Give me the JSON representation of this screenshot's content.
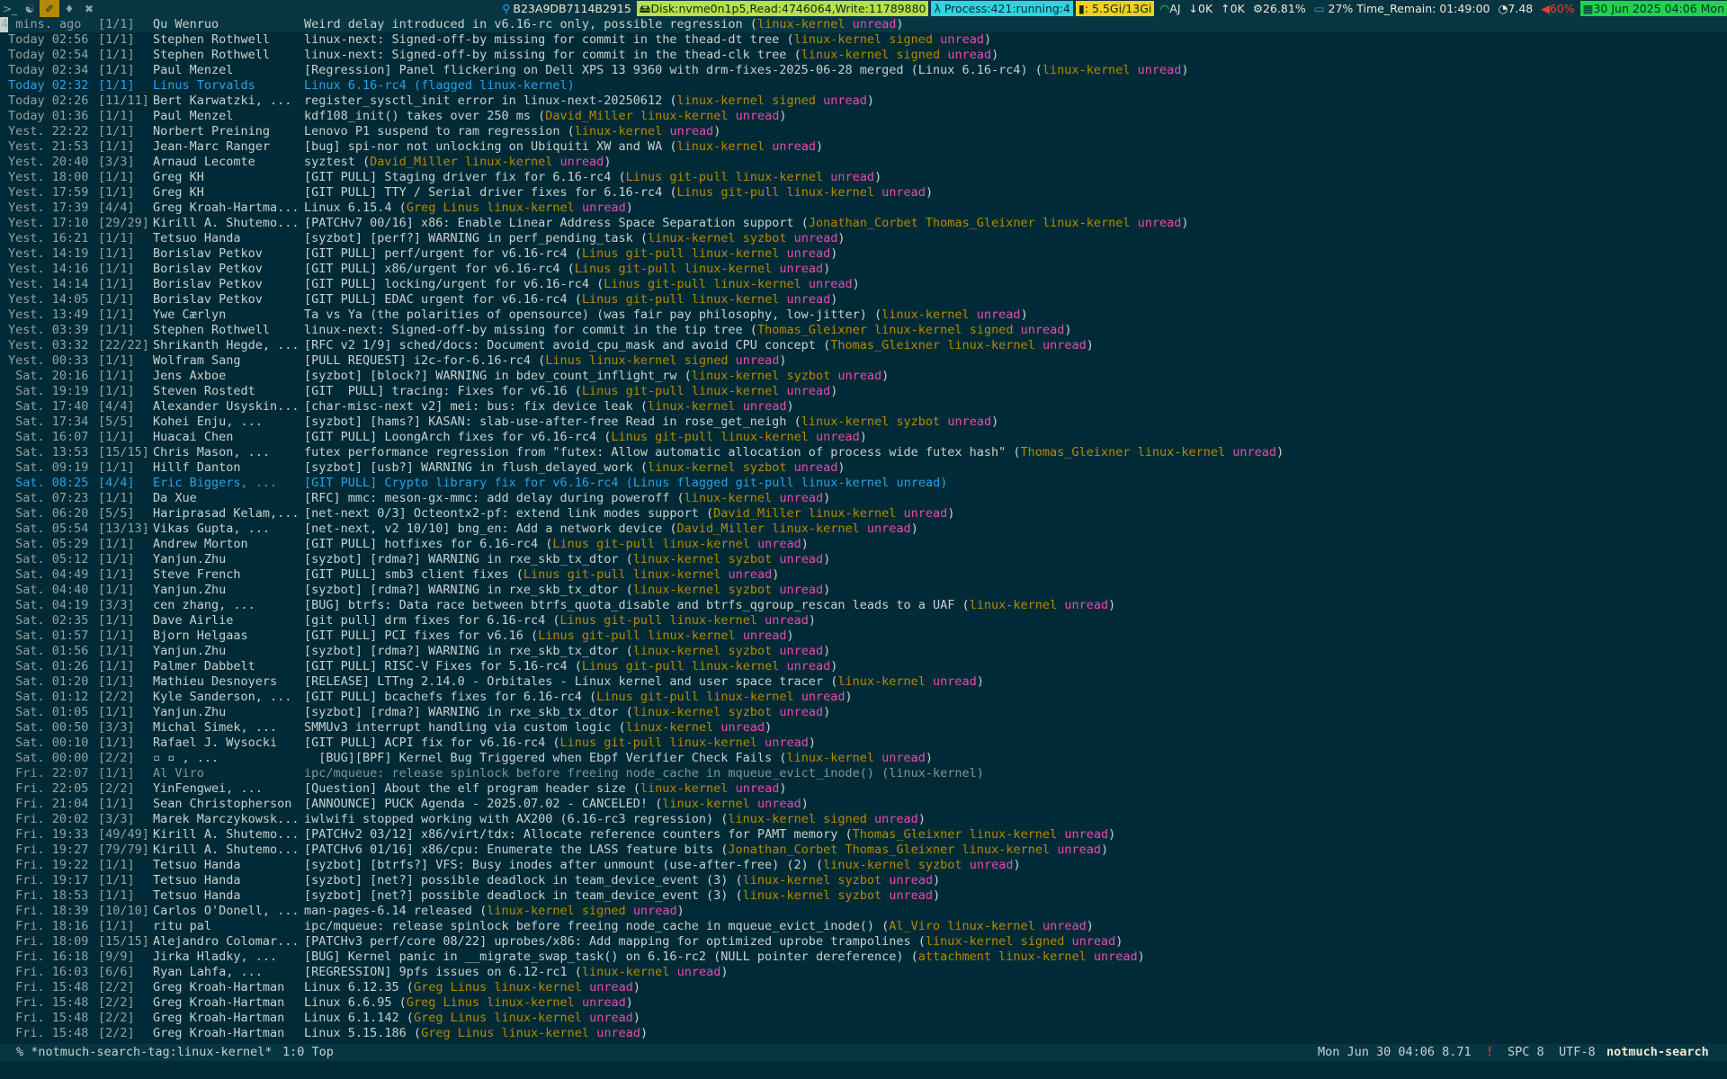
{
  "topbar": {
    "workspaces": [
      {
        "icon": "terminal-icon",
        "glyph": ">_"
      },
      {
        "icon": "emacs-icon",
        "glyph": "☯"
      },
      {
        "icon": "firefox-icon",
        "glyph": "✐"
      },
      {
        "icon": "bell-icon",
        "glyph": "♦"
      },
      {
        "icon": "tools-icon",
        "glyph": "✖"
      }
    ],
    "active_workspace": 2,
    "ip": "B23A9DB7114B2915",
    "disk": "Disk:nvme0n1p5,Read:4746064,Write:11789880",
    "process": "Process:421:running:4",
    "memory": ": 5.5Gi/13Gi",
    "wifi": "AJ",
    "down": "0K",
    "up": "0K",
    "cpu": "26.81%",
    "battery": "27% Time_Remain: 01:49:00",
    "load": "7.48",
    "temp": "60%",
    "datetime": "30 Jun 2025 04:06 Mon"
  },
  "rows": [
    {
      "date": "4 mins. ago",
      "count": "[1/1]",
      "author": "Qu Wenruo",
      "subject": "Weird delay introduced in v6.16-rc only, possible regression",
      "tags": [
        "linux-kernel",
        "unread"
      ]
    },
    {
      "date": "Today 02:56",
      "count": "[1/1]",
      "author": "Stephen Rothwell",
      "subject": "linux-next: Signed-off-by missing for commit in the thead-dt tree",
      "tags": [
        "linux-kernel",
        "signed",
        "unread"
      ]
    },
    {
      "date": "Today 02:54",
      "count": "[1/1]",
      "author": "Stephen Rothwell",
      "subject": "linux-next: Signed-off-by missing for commit in the thead-clk tree",
      "tags": [
        "linux-kernel",
        "signed",
        "unread"
      ]
    },
    {
      "date": "Today 02:34",
      "count": "[1/1]",
      "author": "Paul Menzel",
      "subject": "[Regression] Panel flickering on Dell XPS 13 9360 with drm-fixes-2025-06-28 merged (Linux 6.16-rc4)",
      "tags": [
        "linux-kernel",
        "unread"
      ]
    },
    {
      "date": "Today 02:32",
      "count": "[1/1]",
      "author": "Linus Torvalds",
      "subject": "Linux 6.16-rc4",
      "tags": [
        "flagged",
        "linux-kernel"
      ],
      "flagged": true
    },
    {
      "date": "Today 02:26",
      "count": "[11/11]",
      "author": "Bert Karwatzki, ...",
      "subject": "register_sysctl_init error in linux-next-20250612",
      "tags": [
        "linux-kernel",
        "signed",
        "unread"
      ]
    },
    {
      "date": "Today 01:36",
      "count": "[1/1]",
      "author": "Paul Menzel",
      "subject": "kdf108_init() takes over 250 ms",
      "tags": [
        "David_Miller",
        "linux-kernel",
        "unread"
      ]
    },
    {
      "date": "Yest. 22:22",
      "count": "[1/1]",
      "author": "Norbert Preining",
      "subject": "Lenovo P1 suspend to ram regression",
      "tags": [
        "linux-kernel",
        "unread"
      ]
    },
    {
      "date": "Yest. 21:53",
      "count": "[1/1]",
      "author": "Jean-Marc Ranger",
      "subject": "[bug] spi-nor not unlocking on Ubiquiti XW and WA",
      "tags": [
        "linux-kernel",
        "unread"
      ]
    },
    {
      "date": "Yest. 20:40",
      "count": "[3/3]",
      "author": "Arnaud Lecomte",
      "subject": "syztest",
      "tags": [
        "David_Miller",
        "linux-kernel",
        "unread"
      ]
    },
    {
      "date": "Yest. 18:00",
      "count": "[1/1]",
      "author": "Greg KH",
      "subject": "[GIT PULL] Staging driver fix for 6.16-rc4",
      "tags": [
        "Linus",
        "git-pull",
        "linux-kernel",
        "unread"
      ]
    },
    {
      "date": "Yest. 17:59",
      "count": "[1/1]",
      "author": "Greg KH",
      "subject": "[GIT PULL] TTY / Serial driver fixes for 6.16-rc4",
      "tags": [
        "Linus",
        "git-pull",
        "linux-kernel",
        "unread"
      ]
    },
    {
      "date": "Yest. 17:39",
      "count": "[4/4]",
      "author": "Greg Kroah-Hartma...",
      "subject": "Linux 6.15.4",
      "tags": [
        "Greg",
        "Linus",
        "linux-kernel",
        "unread"
      ]
    },
    {
      "date": "Yest. 17:10",
      "count": "[29/29]",
      "author": "Kirill A. Shutemo...",
      "subject": "[PATCHv7 00/16] x86: Enable Linear Address Space Separation support",
      "tags": [
        "Jonathan_Corbet",
        "Thomas_Gleixner",
        "linux-kernel",
        "unread"
      ]
    },
    {
      "date": "Yest. 16:21",
      "count": "[1/1]",
      "author": "Tetsuo Handa",
      "subject": "[syzbot] [perf?] WARNING in perf_pending_task",
      "tags": [
        "linux-kernel",
        "syzbot",
        "unread"
      ]
    },
    {
      "date": "Yest. 14:19",
      "count": "[1/1]",
      "author": "Borislav Petkov",
      "subject": "[GIT PULL] perf/urgent for v6.16-rc4",
      "tags": [
        "Linus",
        "git-pull",
        "linux-kernel",
        "unread"
      ]
    },
    {
      "date": "Yest. 14:16",
      "count": "[1/1]",
      "author": "Borislav Petkov",
      "subject": "[GIT PULL] x86/urgent for v6.16-rc4",
      "tags": [
        "Linus",
        "git-pull",
        "linux-kernel",
        "unread"
      ]
    },
    {
      "date": "Yest. 14:14",
      "count": "[1/1]",
      "author": "Borislav Petkov",
      "subject": "[GIT PULL] locking/urgent for v6.16-rc4",
      "tags": [
        "Linus",
        "git-pull",
        "linux-kernel",
        "unread"
      ]
    },
    {
      "date": "Yest. 14:05",
      "count": "[1/1]",
      "author": "Borislav Petkov",
      "subject": "[GIT PULL] EDAC urgent for v6.16-rc4",
      "tags": [
        "Linus",
        "git-pull",
        "linux-kernel",
        "unread"
      ]
    },
    {
      "date": "Yest. 13:49",
      "count": "[1/1]",
      "author": "Ywe Cærlyn",
      "subject": "Ta vs Ya (the polarities of opensource) (was fair pay philosophy, low-jitter)",
      "tags": [
        "linux-kernel",
        "unread"
      ]
    },
    {
      "date": "Yest. 03:39",
      "count": "[1/1]",
      "author": "Stephen Rothwell",
      "subject": "linux-next: Signed-off-by missing for commit in the tip tree",
      "tags": [
        "Thomas_Gleixner",
        "linux-kernel",
        "signed",
        "unread"
      ]
    },
    {
      "date": "Yest. 03:32",
      "count": "[22/22]",
      "author": "Shrikanth Hegde, ...",
      "subject": "[RFC v2 1/9] sched/docs: Document avoid_cpu_mask and avoid CPU concept",
      "tags": [
        "Thomas_Gleixner",
        "linux-kernel",
        "unread"
      ]
    },
    {
      "date": "Yest. 00:33",
      "count": "[1/1]",
      "author": "Wolfram Sang",
      "subject": "[PULL REQUEST] i2c-for-6.16-rc4",
      "tags": [
        "Linus",
        "linux-kernel",
        "signed",
        "unread"
      ]
    },
    {
      "date": " Sat. 20:16",
      "count": "[1/1]",
      "author": "Jens Axboe",
      "subject": "[syzbot] [block?] WARNING in bdev_count_inflight_rw",
      "tags": [
        "linux-kernel",
        "syzbot",
        "unread"
      ]
    },
    {
      "date": " Sat. 19:19",
      "count": "[1/1]",
      "author": "Steven Rostedt",
      "subject": "[GIT  PULL] tracing: Fixes for v6.16",
      "tags": [
        "Linus",
        "git-pull",
        "linux-kernel",
        "unread"
      ]
    },
    {
      "date": " Sat. 17:40",
      "count": "[4/4]",
      "author": "Alexander Usyskin...",
      "subject": "[char-misc-next v2] mei: bus: fix device leak",
      "tags": [
        "linux-kernel",
        "unread"
      ]
    },
    {
      "date": " Sat. 17:34",
      "count": "[5/5]",
      "author": "Kohei Enju, ...",
      "subject": "[syzbot] [hams?] KASAN: slab-use-after-free Read in rose_get_neigh",
      "tags": [
        "linux-kernel",
        "syzbot",
        "unread"
      ]
    },
    {
      "date": " Sat. 16:07",
      "count": "[1/1]",
      "author": "Huacai Chen",
      "subject": "[GIT PULL] LoongArch fixes for v6.16-rc4",
      "tags": [
        "Linus",
        "git-pull",
        "linux-kernel",
        "unread"
      ]
    },
    {
      "date": " Sat. 13:53",
      "count": "[15/15]",
      "author": "Chris Mason, ...",
      "subject": "futex performance regression from \"futex: Allow automatic allocation of process wide futex hash\"",
      "tags": [
        "Thomas_Gleixner",
        "linux-kernel",
        "unread"
      ]
    },
    {
      "date": " Sat. 09:19",
      "count": "[1/1]",
      "author": "Hillf Danton",
      "subject": "[syzbot] [usb?] WARNING in flush_delayed_work",
      "tags": [
        "linux-kernel",
        "syzbot",
        "unread"
      ]
    },
    {
      "date": " Sat. 08:25",
      "count": "[4/4]",
      "author": "Eric Biggers, ...",
      "subject": "[GIT PULL] Crypto library fix for v6.16-rc4",
      "tags": [
        "Linus",
        "flagged",
        "git-pull",
        "linux-kernel",
        "unread"
      ],
      "flagged": true
    },
    {
      "date": " Sat. 07:23",
      "count": "[1/1]",
      "author": "Da Xue",
      "subject": "[RFC] mmc: meson-gx-mmc: add delay during poweroff",
      "tags": [
        "linux-kernel",
        "unread"
      ]
    },
    {
      "date": " Sat. 06:20",
      "count": "[5/5]",
      "author": "Hariprasad Kelam,...",
      "subject": "[net-next 0/3] Octeontx2-pf: extend link modes support",
      "tags": [
        "David_Miller",
        "linux-kernel",
        "unread"
      ]
    },
    {
      "date": " Sat. 05:54",
      "count": "[13/13]",
      "author": "Vikas Gupta, ...",
      "subject": "[net-next, v2 10/10] bng_en: Add a network device",
      "tags": [
        "David_Miller",
        "linux-kernel",
        "unread"
      ]
    },
    {
      "date": " Sat. 05:29",
      "count": "[1/1]",
      "author": "Andrew Morton",
      "subject": "[GIT PULL] hotfixes for 6.16-rc4",
      "tags": [
        "Linus",
        "git-pull",
        "linux-kernel",
        "unread"
      ]
    },
    {
      "date": " Sat. 05:12",
      "count": "[1/1]",
      "author": "Yanjun.Zhu",
      "subject": "[syzbot] [rdma?] WARNING in rxe_skb_tx_dtor",
      "tags": [
        "linux-kernel",
        "syzbot",
        "unread"
      ]
    },
    {
      "date": " Sat. 04:49",
      "count": "[1/1]",
      "author": "Steve French",
      "subject": "[GIT PULL] smb3 client fixes",
      "tags": [
        "Linus",
        "git-pull",
        "linux-kernel",
        "unread"
      ]
    },
    {
      "date": " Sat. 04:40",
      "count": "[1/1]",
      "author": "Yanjun.Zhu",
      "subject": "[syzbot] [rdma?] WARNING in rxe_skb_tx_dtor",
      "tags": [
        "linux-kernel",
        "syzbot",
        "unread"
      ]
    },
    {
      "date": " Sat. 04:19",
      "count": "[3/3]",
      "author": "cen zhang, ...",
      "subject": "[BUG] btrfs: Data race between btrfs_quota_disable and btrfs_qgroup_rescan leads to a UAF",
      "tags": [
        "linux-kernel",
        "unread"
      ]
    },
    {
      "date": " Sat. 02:35",
      "count": "[1/1]",
      "author": "Dave Airlie",
      "subject": "[git pull] drm fixes for 6.16-rc4",
      "tags": [
        "Linus",
        "git-pull",
        "linux-kernel",
        "unread"
      ]
    },
    {
      "date": " Sat. 01:57",
      "count": "[1/1]",
      "author": "Bjorn Helgaas",
      "subject": "[GIT PULL] PCI fixes for v6.16",
      "tags": [
        "Linus",
        "git-pull",
        "linux-kernel",
        "unread"
      ]
    },
    {
      "date": " Sat. 01:56",
      "count": "[1/1]",
      "author": "Yanjun.Zhu",
      "subject": "[syzbot] [rdma?] WARNING in rxe_skb_tx_dtor",
      "tags": [
        "linux-kernel",
        "syzbot",
        "unread"
      ]
    },
    {
      "date": " Sat. 01:26",
      "count": "[1/1]",
      "author": "Palmer Dabbelt",
      "subject": "[GIT PULL] RISC-V Fixes for 5.16-rc4",
      "tags": [
        "Linus",
        "git-pull",
        "linux-kernel",
        "unread"
      ]
    },
    {
      "date": " Sat. 01:20",
      "count": "[1/1]",
      "author": "Mathieu Desnoyers",
      "subject": "[RELEASE] LTTng 2.14.0 - Orbitales - Linux kernel and user space tracer",
      "tags": [
        "linux-kernel",
        "unread"
      ]
    },
    {
      "date": " Sat. 01:12",
      "count": "[2/2]",
      "author": "Kyle Sanderson, ...",
      "subject": "[GIT PULL] bcachefs fixes for 6.16-rc4",
      "tags": [
        "Linus",
        "git-pull",
        "linux-kernel",
        "unread"
      ]
    },
    {
      "date": " Sat. 01:05",
      "count": "[1/1]",
      "author": "Yanjun.Zhu",
      "subject": "[syzbot] [rdma?] WARNING in rxe_skb_tx_dtor",
      "tags": [
        "linux-kernel",
        "syzbot",
        "unread"
      ]
    },
    {
      "date": " Sat. 00:50",
      "count": "[3/3]",
      "author": "Michal Simek, ...",
      "subject": "SMMUv3 interrupt handling via custom logic",
      "tags": [
        "linux-kernel",
        "unread"
      ]
    },
    {
      "date": " Sat. 00:10",
      "count": "[1/1]",
      "author": "Rafael J. Wysocki",
      "subject": "[GIT PULL] ACPI fix for v6.16-rc4",
      "tags": [
        "Linus",
        "git-pull",
        "linux-kernel",
        "unread"
      ]
    },
    {
      "date": " Sat. 00:00",
      "count": "[2/2]",
      "author": "▫ ▫ , ...",
      "subject": "  [BUG][BPF] Kernel Bug Triggered when Ebpf Verifier Check Fails",
      "tags": [
        "linux-kernel",
        "unread"
      ]
    },
    {
      "date": " Fri. 22:07",
      "count": "[1/1]",
      "author": "Al Viro",
      "subject": "ipc/mqueue: release spinlock before freeing node_cache in mqueue_evict_inode()",
      "tags": [
        "linux-kernel"
      ],
      "read": true
    },
    {
      "date": " Fri. 22:05",
      "count": "[2/2]",
      "author": "YinFengwei, ...",
      "subject": "[Question] About the elf program header size",
      "tags": [
        "linux-kernel",
        "unread"
      ]
    },
    {
      "date": " Fri. 21:04",
      "count": "[1/1]",
      "author": "Sean Christopherson",
      "subject": "[ANNOUNCE] PUCK Agenda - 2025.07.02 - CANCELED!",
      "tags": [
        "linux-kernel",
        "unread"
      ]
    },
    {
      "date": " Fri. 20:02",
      "count": "[3/3]",
      "author": "Marek Marczykowsk...",
      "subject": "iwlwifi stopped working with AX200 (6.16-rc3 regression)",
      "tags": [
        "linux-kernel",
        "signed",
        "unread"
      ]
    },
    {
      "date": " Fri. 19:33",
      "count": "[49/49]",
      "author": "Kirill A. Shutemo...",
      "subject": "[PATCHv2 03/12] x86/virt/tdx: Allocate reference counters for PAMT memory",
      "tags": [
        "Thomas_Gleixner",
        "linux-kernel",
        "unread"
      ]
    },
    {
      "date": " Fri. 19:27",
      "count": "[79/79]",
      "author": "Kirill A. Shutemo...",
      "subject": "[PATCHv6 01/16] x86/cpu: Enumerate the LASS feature bits",
      "tags": [
        "Jonathan_Corbet",
        "Thomas_Gleixner",
        "linux-kernel",
        "unread"
      ]
    },
    {
      "date": " Fri. 19:22",
      "count": "[1/1]",
      "author": "Tetsuo Handa",
      "subject": "[syzbot] [btrfs?] VFS: Busy inodes after unmount (use-after-free) (2)",
      "tags": [
        "linux-kernel",
        "syzbot",
        "unread"
      ]
    },
    {
      "date": " Fri. 19:17",
      "count": "[1/1]",
      "author": "Tetsuo Handa",
      "subject": "[syzbot] [net?] possible deadlock in team_device_event (3)",
      "tags": [
        "linux-kernel",
        "syzbot",
        "unread"
      ]
    },
    {
      "date": " Fri. 18:53",
      "count": "[1/1]",
      "author": "Tetsuo Handa",
      "subject": "[syzbot] [net?] possible deadlock in team_device_event (3)",
      "tags": [
        "linux-kernel",
        "syzbot",
        "unread"
      ]
    },
    {
      "date": " Fri. 18:39",
      "count": "[10/10]",
      "author": "Carlos O'Donell, ...",
      "subject": "man-pages-6.14 released",
      "tags": [
        "linux-kernel",
        "signed",
        "unread"
      ]
    },
    {
      "date": " Fri. 18:16",
      "count": "[1/1]",
      "author": "ritu pal",
      "subject": "ipc/mqueue: release spinlock before freeing node_cache in mqueue_evict_inode()",
      "tags": [
        "Al_Viro",
        "linux-kernel",
        "unread"
      ]
    },
    {
      "date": " Fri. 18:09",
      "count": "[15/15]",
      "author": "Alejandro Colomar...",
      "subject": "[PATCHv3 perf/core 08/22] uprobes/x86: Add mapping for optimized uprobe trampolines",
      "tags": [
        "linux-kernel",
        "signed",
        "unread"
      ]
    },
    {
      "date": " Fri. 16:18",
      "count": "[9/9]",
      "author": "Jirka Hladky, ...",
      "subject": "[BUG] Kernel panic in __migrate_swap_task() on 6.16-rc2 (NULL pointer dereference)",
      "tags": [
        "attachment",
        "linux-kernel",
        "unread"
      ]
    },
    {
      "date": " Fri. 16:03",
      "count": "[6/6]",
      "author": "Ryan Lahfa, ...",
      "subject": "[REGRESSION] 9pfs issues on 6.12-rc1",
      "tags": [
        "linux-kernel",
        "unread"
      ]
    },
    {
      "date": " Fri. 15:48",
      "count": "[2/2]",
      "author": "Greg Kroah-Hartman",
      "subject": "Linux 6.12.35",
      "tags": [
        "Greg",
        "Linus",
        "linux-kernel",
        "unread"
      ]
    },
    {
      "date": " Fri. 15:48",
      "count": "[2/2]",
      "author": "Greg Kroah-Hartman",
      "subject": "Linux 6.6.95",
      "tags": [
        "Greg",
        "Linus",
        "linux-kernel",
        "unread"
      ]
    },
    {
      "date": " Fri. 15:48",
      "count": "[2/2]",
      "author": "Greg Kroah-Hartman",
      "subject": "Linux 6.1.142",
      "tags": [
        "Greg",
        "Linus",
        "linux-kernel",
        "unread"
      ]
    },
    {
      "date": " Fri. 15:48",
      "count": "[2/2]",
      "author": "Greg Kroah-Hartman",
      "subject": "Linux 5.15.186",
      "tags": [
        "Greg",
        "Linus",
        "linux-kernel",
        "unread"
      ]
    }
  ],
  "modeline": {
    "left": "% *notmuch-search-tag:linux-kernel*",
    "position": "1:0 Top",
    "time": "Mon Jun 30 04:06 8.71",
    "warning": "!",
    "spc": "SPC 8",
    "encoding": "UTF-8",
    "mode": "notmuch-search"
  },
  "colors": {
    "background": "#002b36",
    "tag": "#b58900",
    "unread": "#e64ab4",
    "flagged": "#2aa1e8"
  }
}
